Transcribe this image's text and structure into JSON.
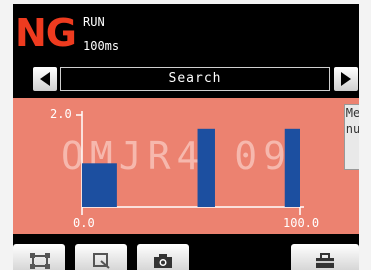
{
  "status": {
    "judgement": "NG",
    "judgement_color": "#ee3b1f",
    "mode": "RUN",
    "processing_time": "100ms"
  },
  "navigation": {
    "prev_icon": "left-arrow-icon",
    "next_icon": "right-arrow-icon",
    "title": "Search"
  },
  "graph": {
    "background_text": "OMJR4 09",
    "background_color": "#ec8270",
    "bar_color": "#1c4fa0",
    "y_tick_top": "2.0",
    "x_tick_min": "0.0",
    "x_tick_max": "100.0"
  },
  "chart_data": {
    "type": "bar",
    "bars": [
      {
        "x_start": 0.0,
        "x_end": 16.0,
        "value": 0.95
      },
      {
        "x_start": 53.0,
        "x_end": 61.0,
        "value": 1.7
      },
      {
        "x_start": 93.0,
        "x_end": 100.0,
        "value": 1.7
      }
    ],
    "xlim": [
      0.0,
      100.0
    ],
    "ylim": [
      0.0,
      2.0
    ],
    "title": "",
    "xlabel": "",
    "ylabel": ""
  },
  "menu": {
    "label": "Menu"
  },
  "toolbar": {
    "buttons": [
      "frame-icon",
      "zoom-icon",
      "camera-icon",
      "toolbox-icon"
    ]
  }
}
